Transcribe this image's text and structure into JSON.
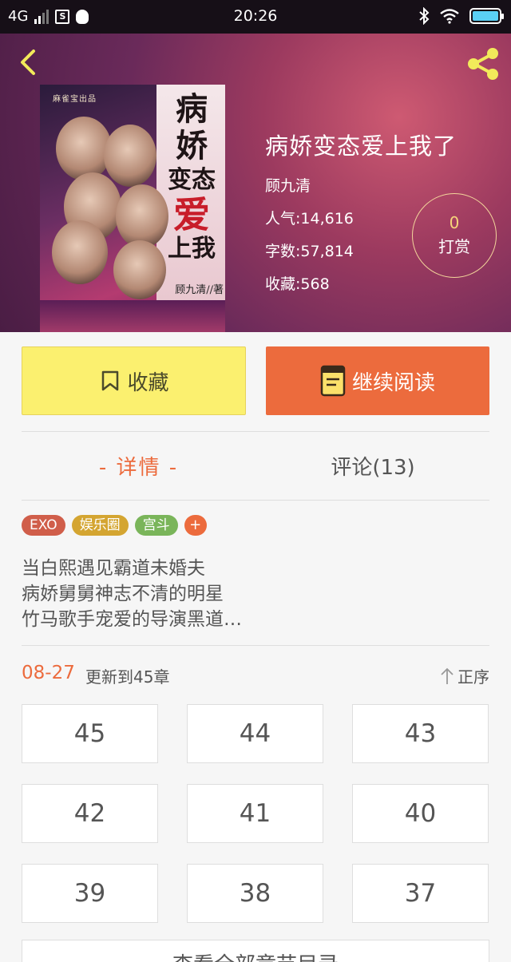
{
  "status_bar": {
    "network": "4G",
    "time": "20:26",
    "sim_icon_text": "S"
  },
  "book": {
    "title": "病娇变态爱上我了",
    "author": "顾九清",
    "popularity": "人气:14,616",
    "word_count": "字数:57,814",
    "favorites": "收藏:568",
    "reward_count": "0",
    "reward_label": "打赏"
  },
  "cover": {
    "title_lines": [
      "病",
      "娇",
      "变态",
      "爱",
      "上我"
    ],
    "author_text": "顾九清//著",
    "publisher_tag": "麻雀宝出品"
  },
  "actions": {
    "collect_label": "收藏",
    "read_label": "继续阅读"
  },
  "tabs": {
    "detail": "- 详情 -",
    "comments": "评论(13)"
  },
  "tags": [
    "EXO",
    "娱乐圈",
    "宫斗"
  ],
  "tag_add": "+",
  "description": {
    "line1": "当白熙遇见霸道未婚夫",
    "line2": "病娇舅舅神志不清的明星",
    "line3": "竹马歌手宠爱的导演黑道…"
  },
  "update": {
    "date": "08-27",
    "info": "更新到45章",
    "sort_label": "正序"
  },
  "chapters": [
    "45",
    "44",
    "43",
    "42",
    "41",
    "40",
    "39",
    "38",
    "37"
  ],
  "more_label": "查看全部章节目录",
  "colors": {
    "accent": "#ec6b3d",
    "collect_bg": "#fbf06f",
    "tag_exo": "#d05e4a",
    "tag_ent": "#d4a531",
    "tag_palace": "#7ab55a"
  }
}
